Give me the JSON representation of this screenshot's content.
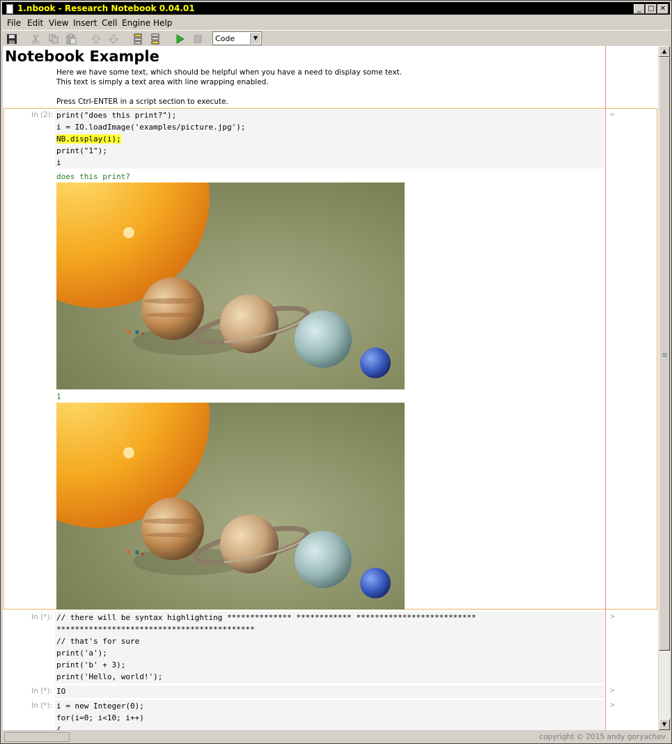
{
  "window": {
    "title": "1.nbook  - Research Notebook 0.04.01",
    "buttons": [
      "_",
      "□",
      "✕"
    ]
  },
  "menu": [
    "File",
    "Edit",
    "View",
    "Insert",
    "Cell",
    "Engine",
    "Help"
  ],
  "toolbar": {
    "icons": [
      "save-icon",
      "cut-icon",
      "copy-icon",
      "paste-icon",
      "move-up-icon",
      "move-down-icon",
      "insert-cell-above-icon",
      "insert-cell-below-icon",
      "run-icon",
      "stop-icon"
    ],
    "cell_type": "Code"
  },
  "notebook": {
    "heading": "Notebook Example",
    "paragraph": [
      "Here we have some text, which should be helpful when you have a need to display some text.",
      "This text is simply a text area with line wrapping enabled.",
      "",
      "Press Ctrl-ENTER in a script section to execute."
    ],
    "cell1": {
      "label": "In (2):",
      "code": [
        "print(\"does this print?\");",
        "i = IO.loadImage('examples/picture.jpg');",
        "NB.display(i);",
        "print(\"1\");",
        "i"
      ],
      "output1": "does this print?",
      "output2": "1",
      "side": "="
    },
    "cell2": {
      "label": "In (*):",
      "code": [
        "// there will be syntax highlighting ************** ************ **************************",
        "*******************************************",
        "// that's for sure",
        "print('a');",
        "print('b' + 3);",
        "print('Hello, world!');"
      ],
      "side": ">"
    },
    "cell3": {
      "label": "In (*):",
      "code": [
        "IO"
      ],
      "side": ">"
    },
    "cell4": {
      "label": "In (*):",
      "code": [
        "i = new Integer(0);",
        "for(i=0; i<10; i++)",
        "{"
      ],
      "side": ">"
    }
  },
  "status": {
    "copyright": "copyright © 2015 andy goryachev"
  },
  "colors": {
    "titlebar_bg": "#000000",
    "titlebar_text": "#ffff00",
    "highlight": "#ffff30",
    "output": "#2a7a2a",
    "focus_border": "#f0b060",
    "margin_line": "#e88a8a"
  }
}
